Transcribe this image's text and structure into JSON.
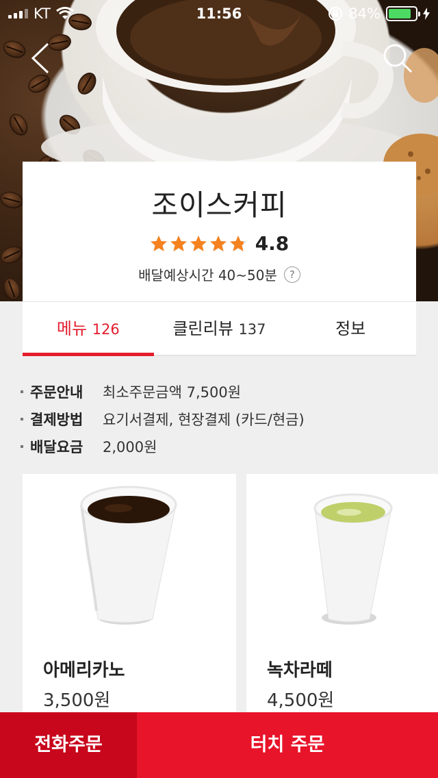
{
  "status_bar": {
    "carrier": "KT",
    "time": "11:56",
    "battery_percent": "84%",
    "battery_level": 0.84,
    "battery_color": "#4cd964"
  },
  "header": {
    "back_icon": "chevron-left-icon",
    "search_icon": "search-icon"
  },
  "store": {
    "name": "조이스커피",
    "rating_value": "4.8",
    "stars_filled": 4.8,
    "stars_total": 5,
    "star_color": "#f5821f",
    "delivery_time": "배달예상시간 40~50분",
    "help_label": "?"
  },
  "tabs": [
    {
      "label": "메뉴",
      "count": "126",
      "active": true
    },
    {
      "label": "클린리뷰",
      "count": "137",
      "active": false
    },
    {
      "label": "정보",
      "count": "",
      "active": false
    }
  ],
  "order_info": [
    {
      "key": "주문안내",
      "value": "최소주문금액 7,500원"
    },
    {
      "key": "결제방법",
      "value": "요기서결제, 현장결제 (카드/현금)"
    },
    {
      "key": "배달요금",
      "value": "2,000원"
    }
  ],
  "menu_items": [
    {
      "name": "아메리카노",
      "price": "3,500원"
    },
    {
      "name": "녹차라떼",
      "price": "4,500원"
    }
  ],
  "bottom_bar": {
    "phone_order": "전화주문",
    "touch_order": "터치 주문",
    "accent_color": "#e8142a"
  }
}
